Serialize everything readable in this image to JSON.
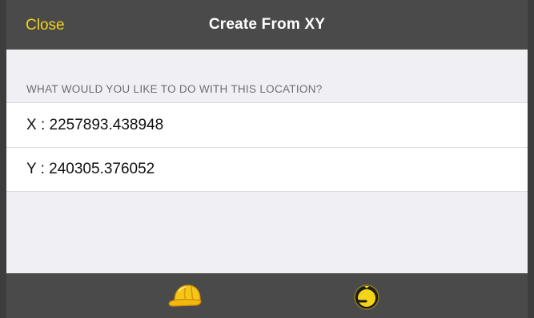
{
  "navbar": {
    "close_label": "Close",
    "title": "Create From XY"
  },
  "section": {
    "header": "WHAT WOULD YOU LIKE TO DO WITH THIS LOCATION?"
  },
  "rows": [
    {
      "label": "X : 2257893.438948"
    },
    {
      "label": "Y : 240305.376052"
    }
  ],
  "toolbar": {
    "items": [
      {
        "icon": "hard-hat-icon"
      },
      {
        "icon": "location-compass-icon"
      }
    ]
  },
  "colors": {
    "navbar_bg": "#4a4a4a",
    "accent_yellow": "#f5d418",
    "background": "#efeff4"
  }
}
